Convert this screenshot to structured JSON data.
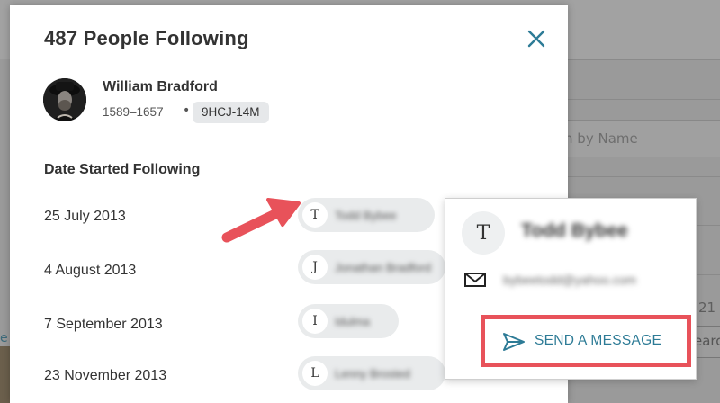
{
  "background": {
    "search_placeholder": "Search by Name",
    "number_fragment": "21",
    "search_button_fragment": "earch",
    "left_link_fragment": "e"
  },
  "modal": {
    "title": "487 People Following",
    "person": {
      "name": "William Bradford",
      "lifespan": "1589–1657",
      "bullet": "•",
      "pid": "9HCJ-14M"
    },
    "section_heading": "Date Started Following",
    "rows": [
      {
        "date": "25 July 2013",
        "initial": "T",
        "name": "Todd Bybee"
      },
      {
        "date": "4 August 2013",
        "initial": "J",
        "name": "Jonathan Bradford"
      },
      {
        "date": "7 September 2013",
        "initial": "I",
        "name": "Idulma"
      },
      {
        "date": "23 November 2013",
        "initial": "L",
        "name": "Lenny Brosted"
      }
    ]
  },
  "popover": {
    "initial": "T",
    "name": "Todd Bybee",
    "email": "bybeetodd@yahoo.com",
    "send_label": "SEND A MESSAGE"
  },
  "colors": {
    "accent": "#2d7b96",
    "annotation": "#e8525a"
  },
  "icons": [
    "close-icon",
    "mail-icon",
    "send-icon"
  ]
}
